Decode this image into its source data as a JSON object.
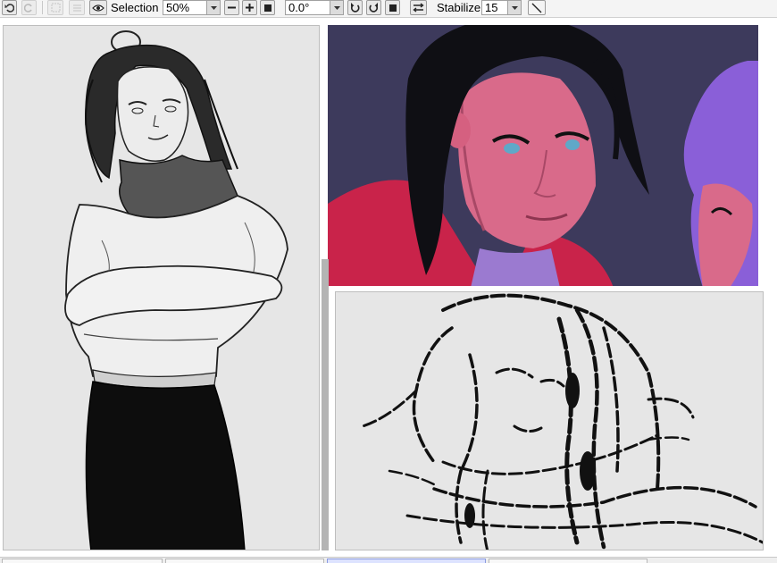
{
  "toolbar": {
    "selection_label": "Selection",
    "zoom_value": "50%",
    "rotation_value": "0.0°",
    "stabilizer_label": "Stabilizer",
    "stabilizer_value": "15",
    "icons": [
      "undo-icon",
      "redo-icon",
      "deselect-icon",
      "invert-selection-icon",
      "eye-icon",
      "zoom-out-icon",
      "zoom-in-icon",
      "zoom-reset-icon",
      "rotate-left-icon",
      "rotate-right-icon",
      "rotate-reset-icon",
      "flip-horizontal-icon",
      "line-tool-icon"
    ]
  },
  "panels": {
    "left": {
      "subject": "grayscale sketch of woman with crossed arms"
    },
    "top_right": {
      "subject": "color painting of dark-haired woman",
      "colors": {
        "background": "#3d3a5c",
        "skin": "#d96a8a",
        "jacket": "#c9234a",
        "hair": "#111111",
        "eyes": "#5fa8c8",
        "accent_hair": "#8a5fd8"
      }
    },
    "bottom_right": {
      "subject": "rough ink line sketch of face"
    }
  },
  "colors": {
    "toolbar_bg": "#f4f4f4",
    "panel_bg": "#e6e6e6",
    "panel_border": "#bdbdbd",
    "divider": "#b0b0b0"
  }
}
